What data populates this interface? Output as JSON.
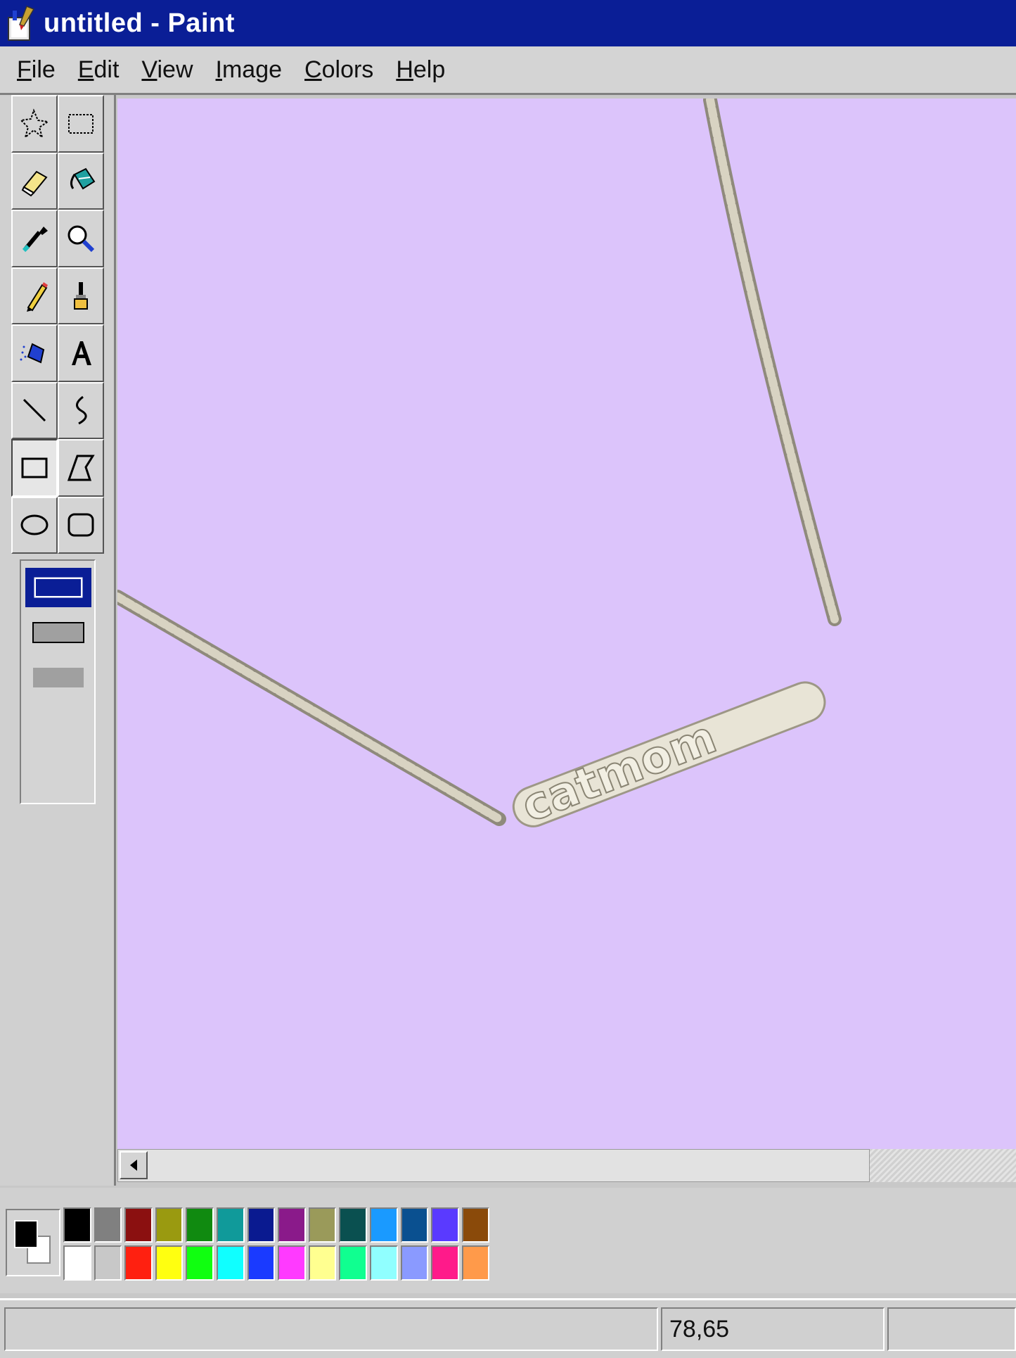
{
  "window": {
    "title": "untitled - Paint"
  },
  "menu": [
    {
      "underline": "F",
      "rest": "ile"
    },
    {
      "underline": "E",
      "rest": "dit"
    },
    {
      "underline": "V",
      "rest": "iew"
    },
    {
      "underline": "I",
      "rest": "mage"
    },
    {
      "underline": "C",
      "rest": "olors"
    },
    {
      "underline": "H",
      "rest": "elp"
    }
  ],
  "tools": [
    "free-form-select",
    "rectangle-select",
    "eraser",
    "fill-with-color",
    "pick-color",
    "magnifier",
    "pencil",
    "brush",
    "airbrush",
    "text",
    "line",
    "curve",
    "rectangle",
    "polygon",
    "ellipse",
    "rounded-rectangle"
  ],
  "selected_tool": "rectangle",
  "canvas": {
    "background": "#dcc4fb",
    "pendant_text": "catmom"
  },
  "palette": {
    "foreground": "#000000",
    "background": "#ffffff",
    "top_row": [
      "#000000",
      "#808080",
      "#8b1010",
      "#9a9a10",
      "#108a10",
      "#109a9a",
      "#0a1a90",
      "#8a1a8a",
      "#9a9a5a",
      "#0a5050",
      "#1a9aff",
      "#0a5090",
      "#5a3aff",
      "#8a4a0a"
    ],
    "bottom_row": [
      "#ffffff",
      "#c8c8c8",
      "#ff2010",
      "#ffff10",
      "#10ff10",
      "#10ffff",
      "#1a3aff",
      "#ff3aff",
      "#ffff90",
      "#10ff90",
      "#90ffff",
      "#8a9aff",
      "#ff1a8a",
      "#ff9a4a"
    ]
  },
  "status": {
    "coordinates": "78,65"
  }
}
